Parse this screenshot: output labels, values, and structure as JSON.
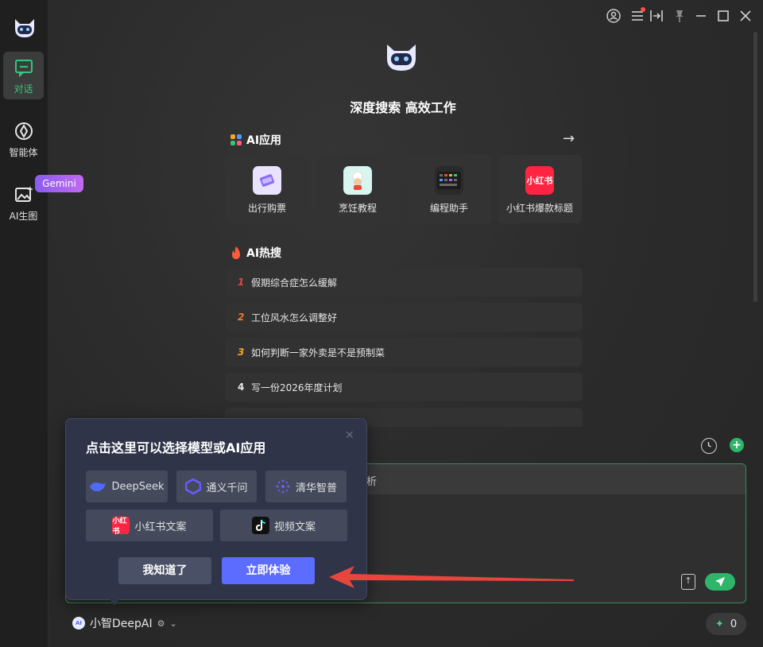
{
  "sidebar": {
    "items": [
      {
        "label": "对话",
        "icon": "chat-icon",
        "active": true
      },
      {
        "label": "智能体",
        "icon": "agent-icon"
      },
      {
        "label": "AI生图",
        "icon": "image-gen-icon"
      }
    ],
    "gemini_badge": "Gemini"
  },
  "header": {
    "title": "深度搜索 高效工作"
  },
  "apps": {
    "title": "AI应用",
    "items": [
      {
        "label": "出行购票",
        "icon": "ticket-icon"
      },
      {
        "label": "烹饪教程",
        "icon": "chef-icon"
      },
      {
        "label": "编程助手",
        "icon": "keyboard-icon"
      },
      {
        "label": "小红书爆款标题",
        "icon_text": "小红书"
      }
    ]
  },
  "hot": {
    "title": "AI热搜",
    "items": [
      {
        "num": "1",
        "text": "假期综合症怎么缓解",
        "color": "#e8453c"
      },
      {
        "num": "2",
        "text": "工位风水怎么调整好",
        "color": "#f07a2e"
      },
      {
        "num": "3",
        "text": "如何判断一家外卖是不是预制菜",
        "color": "#f0a52e"
      },
      {
        "num": "4",
        "text": "写一份2026年度计划",
        "color": "#e8e8e8"
      }
    ]
  },
  "input": {
    "fragment": "析"
  },
  "model": {
    "name": "小智DeepAI",
    "logo_text": "AI"
  },
  "credits": {
    "count": "0"
  },
  "popover": {
    "title": "点击这里可以选择模型或AI应用",
    "chips": [
      {
        "label": "DeepSeek",
        "color": "#4d6bfe"
      },
      {
        "label": "通义千问",
        "color": "#6a5cff"
      },
      {
        "label": "清华智普",
        "color": "#5b4ee8"
      },
      {
        "label": "小红书文案",
        "icon_text": "小红书",
        "color": "#ff2442"
      },
      {
        "label": "视频文案",
        "color": "#111111"
      }
    ],
    "dismiss_label": "我知道了",
    "try_label": "立即体验"
  },
  "colors": {
    "accent_green": "#2fb56a",
    "primary_blue": "#5b6cff",
    "arrow_red": "#e8453c"
  }
}
